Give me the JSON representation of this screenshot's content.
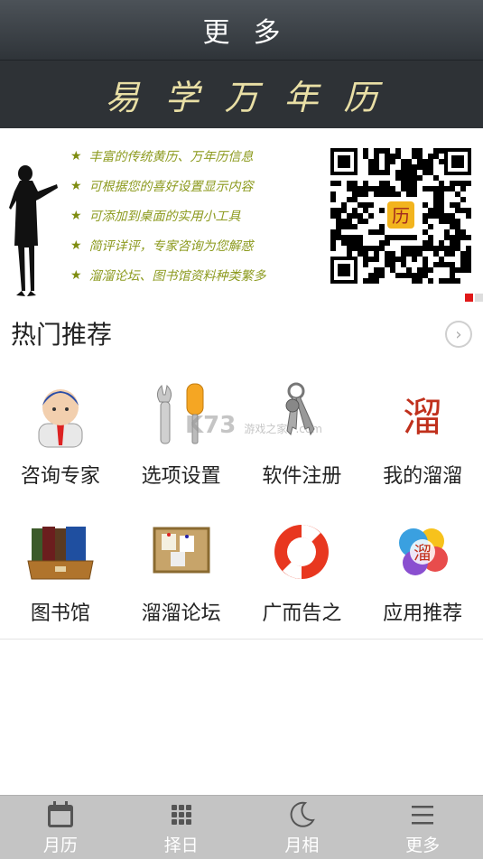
{
  "header": {
    "title": "更多"
  },
  "brand": {
    "name": "易学万年历"
  },
  "banner": {
    "features": [
      "丰富的传统黄历、万年历信息",
      "可根据您的喜好设置显示内容",
      "可添加到桌面的实用小工具",
      "简评详评，专家咨询为您解惑",
      "溜溜论坛、图书馆资料种类繁多"
    ],
    "qr_logo_char": "历",
    "page_indicator": {
      "count": 2,
      "active": 1
    }
  },
  "section": {
    "title": "热门推荐"
  },
  "grid": {
    "items": [
      {
        "label": "咨询专家",
        "icon": "consult-expert-icon"
      },
      {
        "label": "选项设置",
        "icon": "settings-tools-icon"
      },
      {
        "label": "软件注册",
        "icon": "keys-icon"
      },
      {
        "label": "我的溜溜",
        "icon": "liuliu-seal-icon",
        "glyph": "溜"
      },
      {
        "label": "图书馆",
        "icon": "library-books-icon"
      },
      {
        "label": "溜溜论坛",
        "icon": "forum-board-icon"
      },
      {
        "label": "广而告之",
        "icon": "lifebuoy-icon"
      },
      {
        "label": "应用推荐",
        "icon": "app-recommend-icon",
        "glyph": "溜"
      }
    ]
  },
  "watermark": {
    "text": "K73",
    "sub": "游戏之家",
    "domain": ".com"
  },
  "tabbar": {
    "tabs": [
      {
        "label": "月历",
        "icon": "calendar-icon"
      },
      {
        "label": "择日",
        "icon": "grid-icon"
      },
      {
        "label": "月相",
        "icon": "moon-icon"
      },
      {
        "label": "更多",
        "icon": "menu-icon"
      }
    ]
  },
  "colors": {
    "tab_active": "#ffffff",
    "banner_text": "#8c9a1e",
    "brand_text": "#e9dfa5"
  }
}
